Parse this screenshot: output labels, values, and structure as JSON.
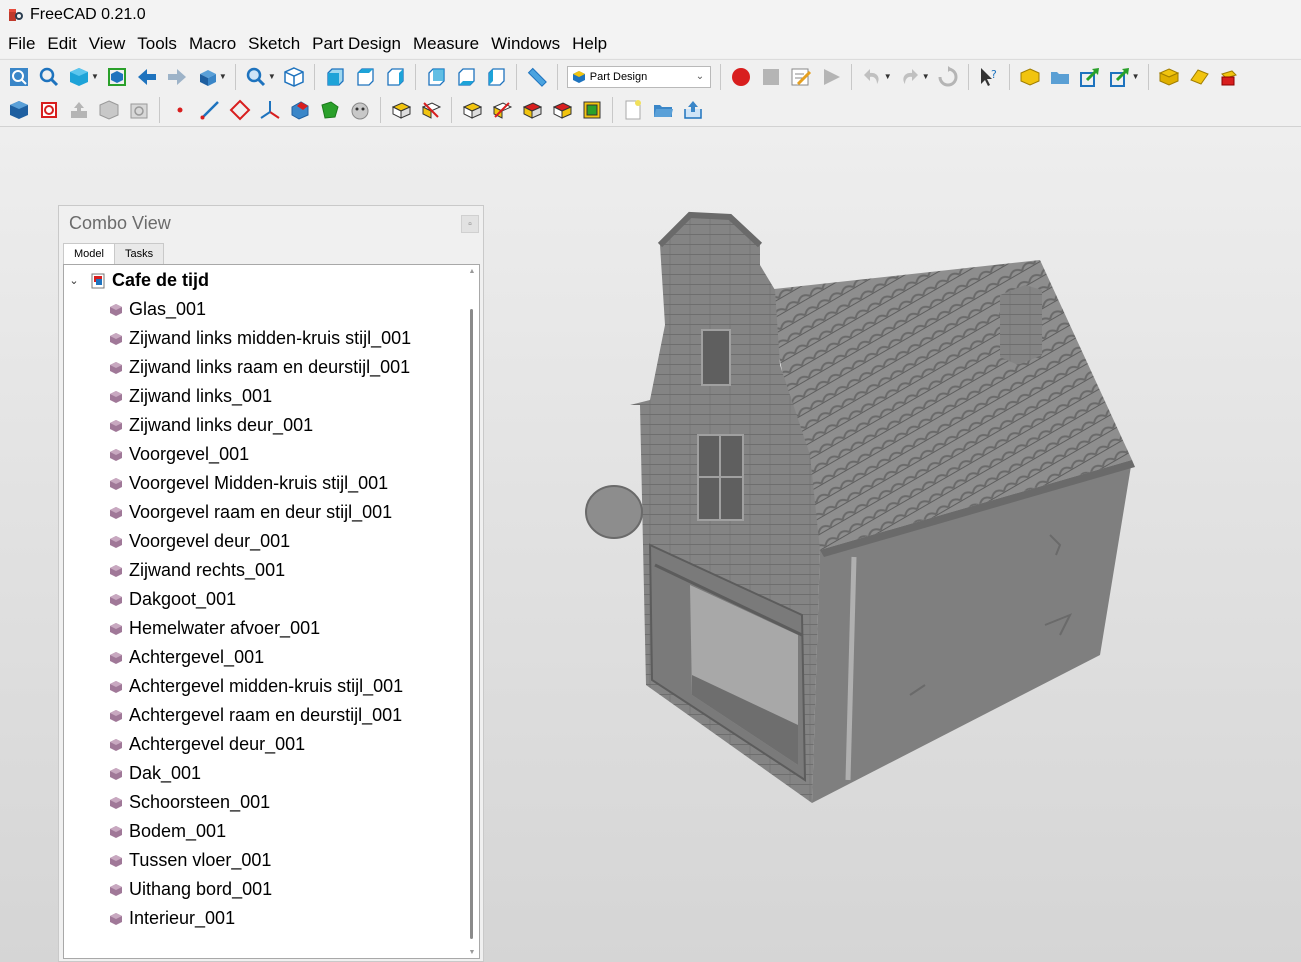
{
  "window": {
    "title": "FreeCAD 0.21.0"
  },
  "menu": [
    "File",
    "Edit",
    "View",
    "Tools",
    "Macro",
    "Sketch",
    "Part Design",
    "Measure",
    "Windows",
    "Help"
  ],
  "toolbar": {
    "workbench_selected": "Part Design"
  },
  "combo_view": {
    "title": "Combo View",
    "tabs": [
      "Model",
      "Tasks"
    ],
    "active_tab": "Model",
    "root": "Cafe de tijd",
    "items": [
      "Glas_001",
      "Zijwand links midden-kruis stijl_001",
      "Zijwand links raam en deurstijl_001",
      "Zijwand links_001",
      "Zijwand links deur_001",
      "Voorgevel_001",
      "Voorgevel Midden-kruis stijl_001",
      "Voorgevel raam en deur stijl_001",
      "Voorgevel deur_001",
      "Zijwand rechts_001",
      "Dakgoot_001",
      "Hemelwater afvoer_001",
      "Achtergevel_001",
      "Achtergevel midden-kruis stijl_001",
      "Achtergevel raam en deurstijl_001",
      "Achtergevel deur_001",
      "Dak_001",
      "Schoorsteen_001",
      "Bodem_001",
      "Tussen vloer_001",
      "Uithang bord_001",
      "Interieur_001"
    ]
  },
  "colors": {
    "model_gray": "#8a8a8a",
    "record_red": "#d81e1e",
    "arrow_green": "#2aa02a",
    "blue_icon": "#1e73be"
  }
}
